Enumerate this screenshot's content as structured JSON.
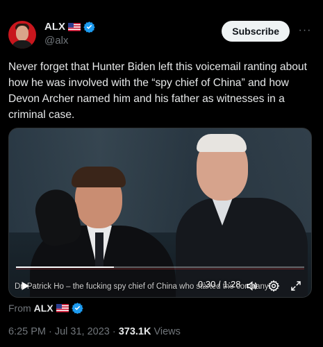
{
  "author": {
    "display_name": "ALX",
    "handle": "@alx"
  },
  "header": {
    "subscribe_label": "Subscribe",
    "more_label": "···"
  },
  "tweet": {
    "text": "Never forget that Hunter Biden left this voicemail ranting about how he was involved with the “spy chief of China” and how Devon Archer named him and his father as witnesses in a criminal case."
  },
  "video": {
    "caption": "Dr. Patrick Ho – the fucking spy chief of China who started the company",
    "time_label": "0:30 / 1:28",
    "progress": 0.34
  },
  "source": {
    "from_label": "From",
    "name": "ALX"
  },
  "meta": {
    "time": "6:25 PM",
    "dot1": "·",
    "date": "Jul 31, 2023",
    "dot2": "·",
    "views_count": "373.1K",
    "views_label": "Views"
  },
  "colors": {
    "verified": "#1d9bf0",
    "muted": "#71767b",
    "text": "#e7e9ea"
  },
  "icons": [
    "more-icon",
    "verified-icon",
    "us-flag-icon",
    "play-icon",
    "volume-icon",
    "settings-gear-icon",
    "fullscreen-icon"
  ]
}
